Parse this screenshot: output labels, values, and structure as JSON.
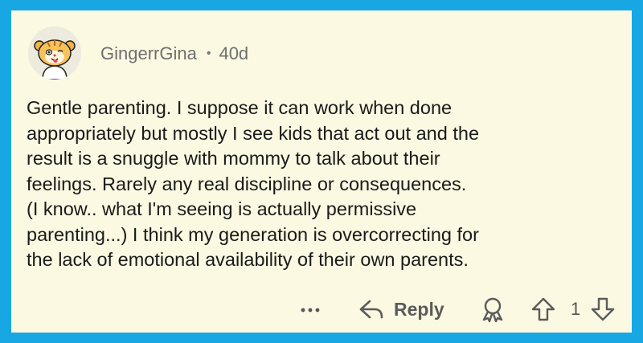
{
  "comment": {
    "username": "GingerrGina",
    "separator": "•",
    "age": "40d",
    "text": "Gentle parenting.   I suppose it can work when done\nappropriately but mostly I see kids that act out and  the\nresult is a snuggle with mommy to talk about their\nfeelings.  Rarely any real discipline or consequences.\n(I know.. what I'm seeing is actually permissive\nparenting...) I think my generation is overcorrecting for\nthe  lack of emotional availability of their own parents."
  },
  "actions": {
    "more_icon": "more-horizontal-icon",
    "reply_icon": "reply-arrow-icon",
    "reply_label": "Reply",
    "award_icon": "award-icon",
    "upvote_icon": "upvote-arrow-icon",
    "vote_count": "1",
    "downvote_icon": "downvote-arrow-icon"
  },
  "colors": {
    "frame": "#17a8e3",
    "card_background": "#fbf9e2",
    "username": "#6f6f6f",
    "text": "#1a1a1a",
    "icon": "#5b5b5b"
  }
}
